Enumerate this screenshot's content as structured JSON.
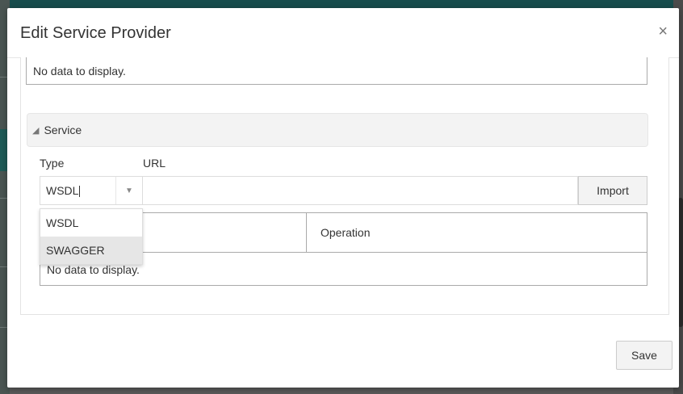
{
  "dialog": {
    "title": "Edit Service Provider",
    "close_icon": "×",
    "save_label": "Save"
  },
  "top_table": {
    "empty_message": "No data to display."
  },
  "service": {
    "section_title": "Service",
    "type_label": "Type",
    "url_label": "URL",
    "type_value": "WSDL",
    "url_value": "",
    "import_label": "Import",
    "options": [
      "WSDL",
      "SWAGGER"
    ],
    "highlighted_option": "SWAGGER",
    "table": {
      "columns": [
        "",
        "Operation"
      ],
      "empty_message": "No data to display."
    }
  },
  "icons": {
    "collapse": "triangle-expanded-icon",
    "dropdown": "chevron-down-icon",
    "close": "close-icon"
  }
}
